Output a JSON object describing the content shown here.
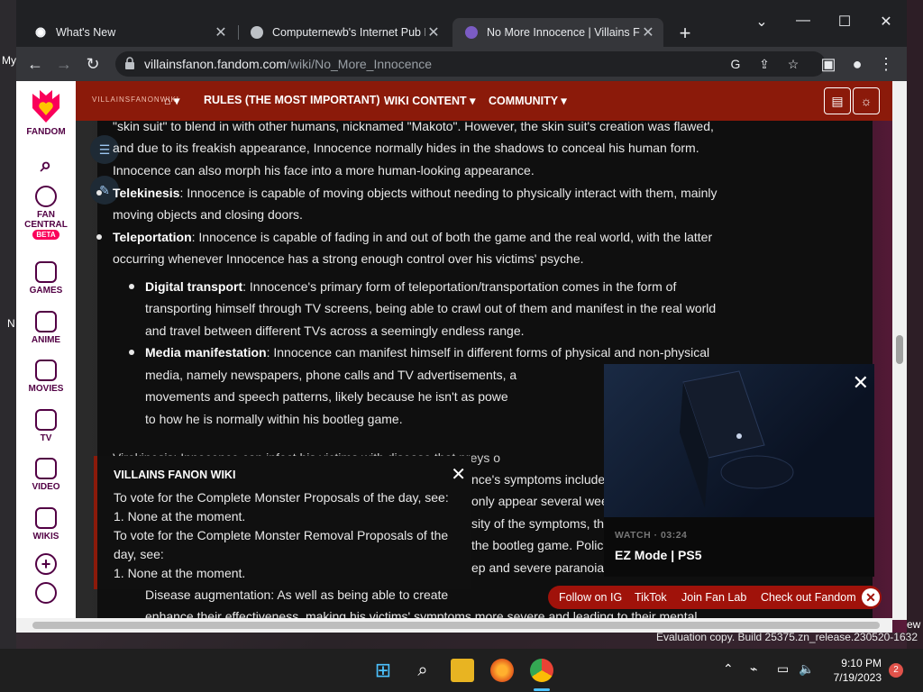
{
  "desktop": {
    "left_partial_1": "My",
    "left_partial_2": "N",
    "right_partial": "ew",
    "evaluation_line": "Evaluation copy. Build 25375.zn_release.230520-1632"
  },
  "browser": {
    "tabs": [
      {
        "title": "What's New",
        "active": false
      },
      {
        "title": "Computernewb's Internet Pub H",
        "active": false
      },
      {
        "title": "No More Innocence | Villains Far",
        "active": true
      }
    ],
    "new_tab_label": "+",
    "url_host": "villainsfanon.fandom.com",
    "url_path": "/wiki/No_More_Innocence"
  },
  "fandom_rail": {
    "brand": "FANDOM",
    "items": [
      {
        "label": "FAN CENTRAL",
        "badge": "BETA"
      },
      {
        "label": "GAMES"
      },
      {
        "label": "ANIME"
      },
      {
        "label": "MOVIES"
      },
      {
        "label": "TV"
      },
      {
        "label": "VIDEO"
      },
      {
        "label": "WIKIS"
      }
    ]
  },
  "wiki_header": {
    "logo_text": "VILLAINSFANONWIKI",
    "nav": [
      {
        "label": "RULES (THE MOST IMPORTANT)"
      },
      {
        "label": "WIKI CONTENT"
      },
      {
        "label": "COMMUNITY"
      }
    ]
  },
  "article": {
    "para_top_1": "\"skin suit\" to blend in with other humans, nicknamed \"Makoto\". However, the skin suit's creation was flawed,",
    "para_top_2": "and due to its freakish appearance, Innocence normally hides in the shadows to conceal his human form.",
    "para_top_3": "Innocence can also morph his face into a more human-looking appearance.",
    "telekinesis_term": "Telekinesis",
    "telekinesis_1": ": Innocence is capable of moving objects without needing to physically interact with them, mainly",
    "telekinesis_2": "moving objects and closing doors.",
    "teleportation_term": "Teleportation",
    "teleportation_1": ": Innocence is capable of fading in and out of both the game and the real world, with the latter",
    "teleportation_2": "occurring whenever Innocence has a strong enough control over his victims' psyche.",
    "digital_term": "Digital transport",
    "digital_1": ": Innocence's primary form of teleportation/transportation comes in the form of",
    "digital_2": "transporting himself through TV screens, being able to crawl out of them and manifest in the real world",
    "digital_3": "and travel between different TVs across a seemingly endless range.",
    "media_term": "Media manifestation",
    "media_1": ": Innocence can manifest himself in different forms of physical and non-physical",
    "media_2": "media, namely newspapers, phone calls and TV advertisements, a",
    "media_3": "movements and speech patterns, likely because he isn't as powe",
    "media_4": "to how he is normally within his bootleg game.",
    "virokinesis_line": "Virokinesis: Innocence can infect his victims with disease that preys o",
    "frag_1": "nce's symptoms include",
    "frag_2": "only appear several wee",
    "frag_3": "sity of the symptoms, th",
    "frag_4": "the bootleg game. Polic",
    "frag_5": "ep and severe paranoia",
    "disease_line": "Disease augmentation: As well as being able to create",
    "enhance_line": "enhance their effectiveness, making his victims' symptoms more severe and leading to their mental"
  },
  "notice": {
    "heading": "VILLAINS FANON WIKI",
    "line1": "To vote for the Complete Monster Proposals of the day, see:",
    "line2": "1. None at the moment.",
    "line3": "To vote for the Complete Monster Removal Proposals of the",
    "line4": "day, see:",
    "line5": "1. None at the moment."
  },
  "video": {
    "meta": "WATCH · 03:24",
    "title": "EZ Mode | PS5"
  },
  "fanbar": {
    "links": [
      "Follow on IG",
      "TikTok",
      "Join Fan Lab",
      "Check out Fandom"
    ]
  },
  "taskbar": {
    "time": "9:10 PM",
    "date": "7/19/2023",
    "notifications": "2"
  },
  "colors": {
    "wiki_red": "#8b1a0a",
    "fandom_pink": "#fa005a",
    "fandom_purple": "#520044"
  }
}
